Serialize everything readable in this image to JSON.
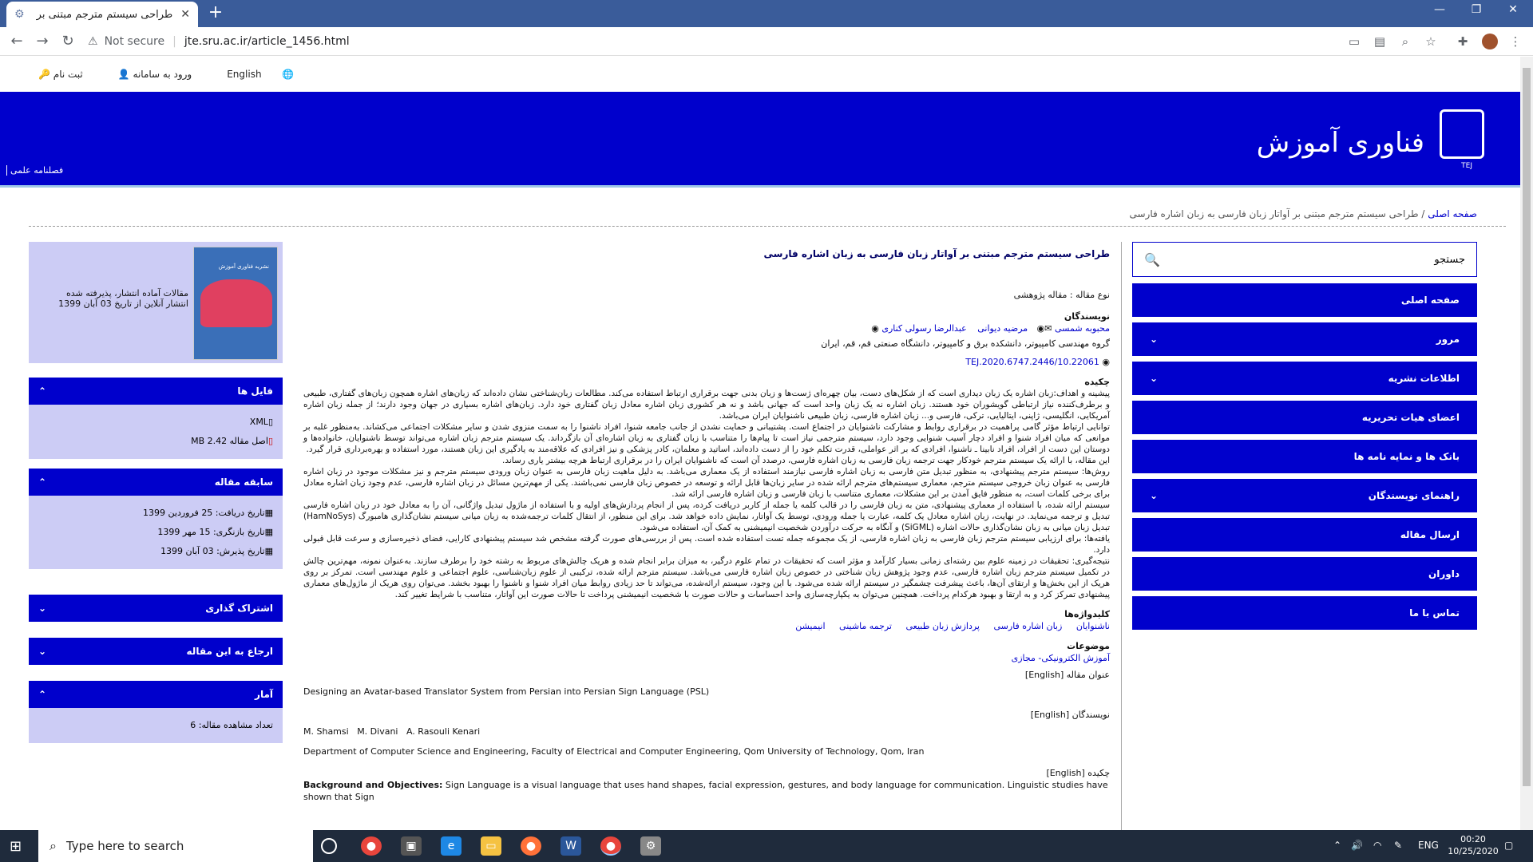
{
  "browser": {
    "tab_title": "طراحی سیستم مترجم مبتنی بر آوا...",
    "new_tab": "+",
    "not_secure": "Not secure",
    "url": "jte.sru.ac.ir/article_1456.html",
    "win_min": "—",
    "win_max": "❐",
    "win_close": "✕"
  },
  "topnav": {
    "english": "English",
    "login": "ورود به سامانه",
    "register": "ثبت نام"
  },
  "banner": {
    "journal_name": "فناوری آموزش",
    "logo_abbr": "TEJ",
    "quarterly_tag": "فصلنامه علمی"
  },
  "breadcrumb": {
    "home": "صفحه اصلی",
    "sep": "/",
    "current": "طراحی سیستم مترجم مبتنی بر آواتار زبان فارسی به زبان اشاره فارسی"
  },
  "search": {
    "placeholder": "جستجو"
  },
  "menu": [
    {
      "label": "صفحه اصلی",
      "chev": ""
    },
    {
      "label": "مرور",
      "chev": "⌄"
    },
    {
      "label": "اطلاعات نشریه",
      "chev": "⌄"
    },
    {
      "label": "اعضای هیات تحریریه",
      "chev": ""
    },
    {
      "label": "بانک ها و نمایه نامه ها",
      "chev": ""
    },
    {
      "label": "راهنمای نویسندگان",
      "chev": "⌄"
    },
    {
      "label": "ارسال مقاله",
      "chev": ""
    },
    {
      "label": "داوران",
      "chev": ""
    },
    {
      "label": "تماس با ما",
      "chev": ""
    }
  ],
  "article": {
    "title": "طراحی سیستم مترجم مبتنی بر آواتار زبان فارسی به زبان اشاره فارسی",
    "type_label": "نوع مقاله : مقاله پژوهشی",
    "authors_label": "نویسندگان",
    "authors": [
      "محبوبه شمسی",
      "مرضیه دیوانی",
      "عبدالرضا رسولی کناری"
    ],
    "affiliation": "گروه مهندسی کامپیوتر، دانشکده برق و کامپیوتر، دانشگاه صنعتی قم، قم، ایران",
    "doi": "10.22061/TEJ.2020.6747.2446",
    "abstract_label": "چکیده",
    "abstract_paragraphs": [
      "پیشینه و اهداف:زبان اشاره یک زبان دیداری است که از شکل‌های دست، بیان چهره‌ای ژست‌ها و زبان بدنی جهت برقراری ارتباط استفاده می‌کند. مطالعات زبان‌شناختی نشان داده‌اند که زبان‌های اشاره همچون زبان‌های گفتاری، طبیعی و برطرف‌کننده نیاز ارتباطی گویشوران خود هستند. زبان اشاره نه یک زبان واحد است که جهانی باشد و نه هر کشوری زبان اشاره معادل زبان گفتاری خود دارد. زبان‌های اشاره بسیاری در جهان وجود دارند؛ از جمله زبان اشاره آمریکایی، انگلیسی، ژاپنی، ایتالیایی، ترکی، فارسی و... زبان اشاره فارسی، زبان طبیعی ناشنوایان ایران می‌باشد.",
      "توانایی ارتباط مؤثر گامی پراهمیت در برقراری روابط و مشارکت ناشنوایان در اجتماع است. پشتیبانی و حمایت نشدن از جانب جامعه شنوا، افراد ناشنوا را به سمت منزوی شدن و سایر مشکلات اجتماعی می‌کشاند. به‌منظور غلبه بر موانعی که میان افراد شنوا و افراد دچار آسیب شنوایی وجود دارد، سیستم مترجمی نیاز است تا پیام‌ها را متناسب با زبان گفتاری به زبان اشاره‌ای آن بازگرداند. یک سیستم مترجم زبان اشاره می‌تواند توسط ناشنوایان، خانواده‌ها و دوستان این دست از افراد، افراد نابینا ـ ناشنوا، افرادی که بر اثر عواملی، قدرت تکلم خود را از دست داده‌اند، اساتید و معلمان، کادر پزشکی و نیز افرادی که علاقه‌مند به یادگیری این زبان هستند، مورد استفاده و بهره‌برداری قرار گیرد.",
      "این مقاله، با ارائه یک سیستم مترجم خودکار جهت ترجمه زبان فارسی به زبان اشاره فارسی، درصدد آن است که ناشنوایان ایران را در برقراری ارتباط هرچه بیشتر یاری رساند.",
      "روش‌ها: سیستم مترجم پیشنهادی، به منظور تبدیل متن فارسی به زبان اشاره فارسی نیازمند استفاده از یک معماری می‌باشد. به دلیل ماهیت زبان فارسی به عنوان زبان ورودی سیستم مترجم و نیز مشکلات موجود در زبان اشاره فارسی به عنوان زبان خروجی سیستم مترجم، معماری سیستم‌های مترجم ارائه شده در سایر زبان‌ها قابل ارائه و توسعه در خصوص زبان فارسی نمی‌باشند. یکی از مهم‌ترین مسائل در زبان اشاره فارسی، عدم وجود زبان اشاره معادل برای برخی کلمات است، به منظور فایق آمدن بر این مشکلات، معماری متناسب با زبان فارسی و زبان اشاره فارسی ارائه شد.",
      "سیستم ارائه شده، با استفاده از معماری پیشنهادی، متن به زبان فارسی را در قالب کلمه یا جمله از کاربر دریافت کرده، پس از انجام پردازش‌های اولیه و با استفاده از ماژول تبدیل واژگانی، آن را به معادل خود در زبان اشاره فارسی تبدیل و ترجمه می‌نماید. در نهایت، زبان اشاره معادل یک کلمه، عبارت یا جمله ورودی، توسط یک آواتار، نمایش داده خواهد شد. برای این منظور، از انتقال کلمات ترجمه‌شده به زبان میانی سیستم نشان‌گذاری هامبورگ (HamNoSys) تبدیل زبان میانی به زبان نشان‌گذاری حالات اشاره (SiGML) و آنگاه به حرکت درآوردن شخصیت انیمیشنی به کمک آن، استفاده می‌شود.",
      "یافته‌ها: برای ارزیابی سیستم مترجم زبان فارسی به زبان اشاره فارسی، از یک مجموعه جمله تست استفاده شده است. پس از بررسی‌های صورت گرفته مشخص شد سیستم پیشنهادی کارایی، فضای ذخیره‌سازی و سرعت قابل قبولی دارد.",
      "نتیجه‌گیری: تحقیقات در زمینه علوم بین رشته‌ای زمانی بسیار کارآمد و مؤثر است که تحقیقات در تمام علوم درگیر، به میزان برابر انجام شده و هریک چالش‌های مربوط به رشته خود را برطرف سازند. به‌عنوان نمونه، مهم‌ترین چالش در تکمیل سیستم مترجم زبان اشاره فارسی، عدم وجود پژوهش زبان شناختی در خصوص زبان اشاره فارسی می‌باشد. سیستم مترجم ارائه شده، ترکیبی از علوم زبان‌شناسی، علوم اجتماعی و علوم مهندسی است. تمرکز بر روی هریک از این بخش‌ها و ارتقای آن‌ها، باعث پیشرفت چشمگیر در سیستم ارائه شده می‌شود. با این وجود، سیستم ارائه‌شده، می‌تواند تا حد زیادی روابط میان افراد شنوا و ناشنوا را بهبود بخشد. می‌توان روی هریک از ماژول‌های معماری پیشنهادی تمرکز کرد و به ارتقا و بهبود هرکدام پرداخت. همچنین می‌توان به یکپارچه‌سازی واحد احساسات و حالات صورت با شخصیت انیمیشنی پرداخت تا حالات صورت این آواتار، متناسب با شرایط تغییر کند."
    ],
    "keywords_label": "کلیدواژه‌ها",
    "keywords": [
      "ناشنوایان",
      "زبان اشاره فارسی",
      "پردازش زبان طبیعی",
      "ترجمه ماشینی",
      "انیمیشن"
    ],
    "subjects_label": "موضوعات",
    "subject": "آموزش الکترونیکی- مجازی",
    "title_en_label": "عنوان مقاله [English]",
    "title_en": "Designing an Avatar-based Translator System from Persian into Persian Sign Language (PSL)",
    "authors_en_label": "نویسندگان [English]",
    "authors_en": [
      "M. Shamsi",
      "M. Divani",
      "A. Rasouli Kenari"
    ],
    "affiliation_en": "Department of Computer Science and Engineering, Faculty of Electrical and Computer Engineering, Qom University of Technology, Qom, Iran",
    "abstract_en_label": "چکیده [English]",
    "abstract_en_start": "Background and Objectives:",
    "abstract_en_text": " Sign Language is a visual language that uses hand shapes, facial expression, gestures, and body language for communication. Linguistic studies have shown that Sign"
  },
  "left": {
    "issue_line1": "مقالات آماده انتشار، پذیرفته شده",
    "issue_line2": "انتشار آنلاین از تاریخ 03 آبان 1399",
    "cover_title": "نشریه فناوری آموزش",
    "files_head": "فایل ها",
    "files": [
      "XML",
      "اصل مقاله 2.42 MB"
    ],
    "history_head": "سابقه مقاله",
    "history": [
      "تاریخ دریافت: 25 فروردین 1399",
      "تاریخ بازنگری: 15 مهر 1399",
      "تاریخ پذیرش: 03 آبان 1399"
    ],
    "share_head": "اشتراک گذاری",
    "cite_head": "ارجاع به این مقاله",
    "stats_head": "آمار",
    "views": "تعداد مشاهده مقاله: 6"
  },
  "taskbar": {
    "search_placeholder": "Type here to search",
    "lang": "ENG",
    "time": "00:20",
    "date": "10/25/2020"
  }
}
